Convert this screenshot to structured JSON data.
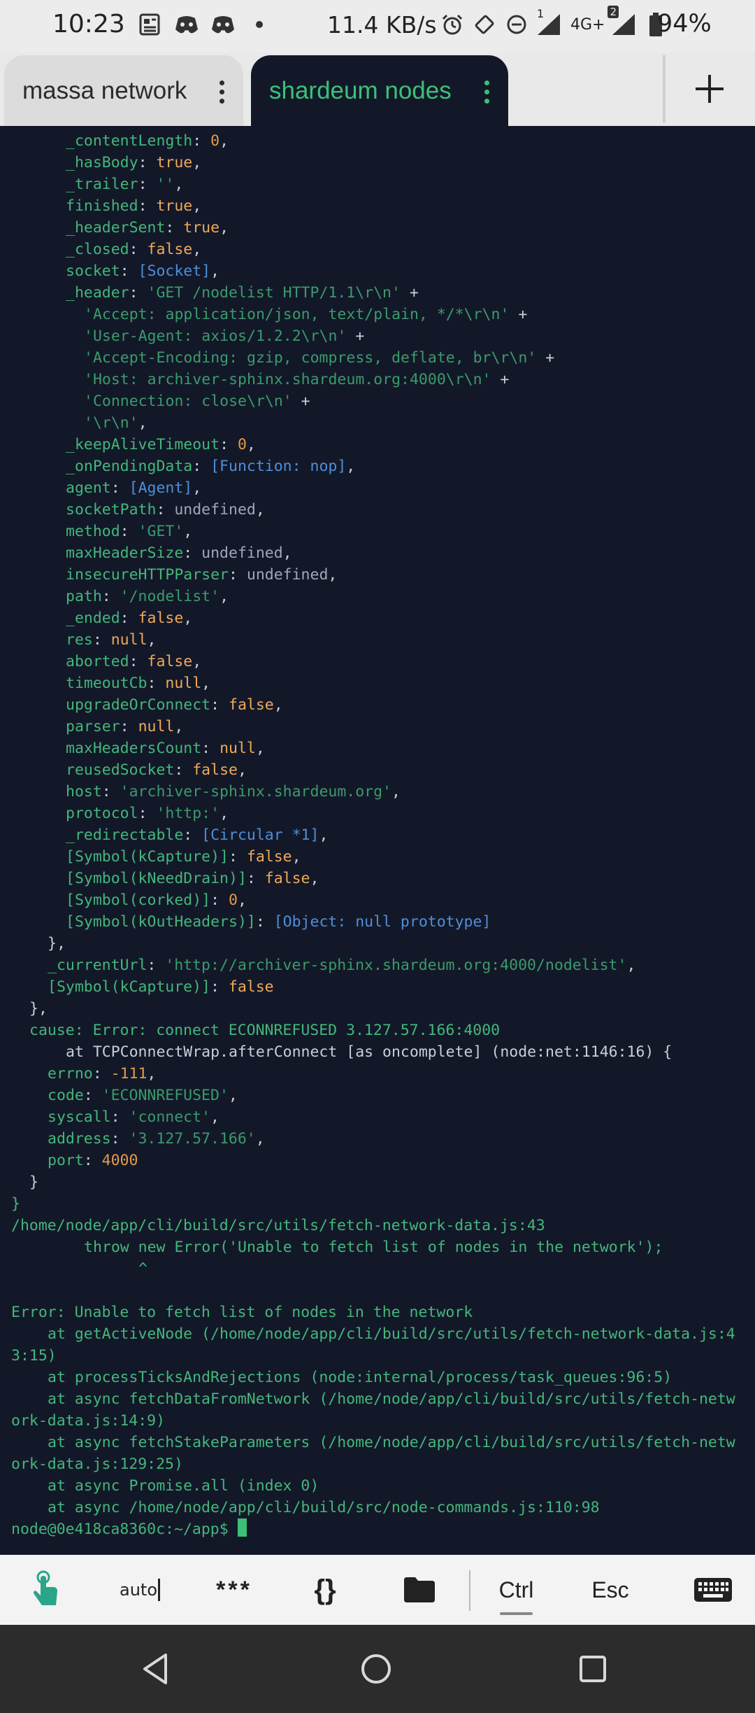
{
  "status_bar": {
    "time": "10:23",
    "net_speed": "11.4 KB/s",
    "sim1_label": "1",
    "network_type": "4G+",
    "sim2_label": "2",
    "battery_percent": "94%",
    "icons_left": [
      "news-icon",
      "discord-icon",
      "discord-icon",
      "dot-icon"
    ],
    "icons_right": [
      "alarm-icon",
      "rotate-icon",
      "dnd-icon",
      "signal-icon",
      "signal-icon",
      "battery-icon"
    ]
  },
  "tabs": [
    {
      "label": "massa network",
      "active": false
    },
    {
      "label": "shardeum nodes",
      "active": true
    }
  ],
  "colors": {
    "accent": "#3cc078",
    "terminal_bg": "#131829",
    "string": "#3a9b6a",
    "number": "#e49a47",
    "special": "#4e8fd9"
  },
  "terminal": {
    "lines": [
      {
        "indent": 6,
        "parts": [
          [
            "k",
            "_contentLength"
          ],
          [
            "p",
            ": "
          ],
          [
            "n",
            "0"
          ],
          [
            "p",
            ","
          ]
        ]
      },
      {
        "indent": 6,
        "parts": [
          [
            "k",
            "_hasBody"
          ],
          [
            "p",
            ": "
          ],
          [
            "b",
            "true"
          ],
          [
            "p",
            ","
          ]
        ]
      },
      {
        "indent": 6,
        "parts": [
          [
            "k",
            "_trailer"
          ],
          [
            "p",
            ": "
          ],
          [
            "s",
            "''"
          ],
          [
            "p",
            ","
          ]
        ]
      },
      {
        "indent": 6,
        "parts": [
          [
            "k",
            "finished"
          ],
          [
            "p",
            ": "
          ],
          [
            "b",
            "true"
          ],
          [
            "p",
            ","
          ]
        ]
      },
      {
        "indent": 6,
        "parts": [
          [
            "k",
            "_headerSent"
          ],
          [
            "p",
            ": "
          ],
          [
            "b",
            "true"
          ],
          [
            "p",
            ","
          ]
        ]
      },
      {
        "indent": 6,
        "parts": [
          [
            "k",
            "_closed"
          ],
          [
            "p",
            ": "
          ],
          [
            "b",
            "false"
          ],
          [
            "p",
            ","
          ]
        ]
      },
      {
        "indent": 6,
        "parts": [
          [
            "k",
            "socket"
          ],
          [
            "p",
            ": "
          ],
          [
            "sp",
            "[Socket]"
          ],
          [
            "p",
            ","
          ]
        ]
      },
      {
        "indent": 6,
        "parts": [
          [
            "k",
            "_header"
          ],
          [
            "p",
            ": "
          ],
          [
            "s",
            "'GET /nodelist HTTP/1.1\\r\\n'"
          ],
          [
            "p",
            " +"
          ]
        ]
      },
      {
        "indent": 8,
        "parts": [
          [
            "s",
            "'Accept: application/json, text/plain, */*\\r\\n'"
          ],
          [
            "p",
            " +"
          ]
        ]
      },
      {
        "indent": 8,
        "parts": [
          [
            "s",
            "'User-Agent: axios/1.2.2\\r\\n'"
          ],
          [
            "p",
            " +"
          ]
        ]
      },
      {
        "indent": 8,
        "parts": [
          [
            "s",
            "'Accept-Encoding: gzip, compress, deflate, br\\r\\n'"
          ],
          [
            "p",
            " +"
          ]
        ]
      },
      {
        "indent": 8,
        "parts": [
          [
            "s",
            "'Host: archiver-sphinx.shardeum.org:4000\\r\\n'"
          ],
          [
            "p",
            " +"
          ]
        ]
      },
      {
        "indent": 8,
        "parts": [
          [
            "s",
            "'Connection: close\\r\\n'"
          ],
          [
            "p",
            " +"
          ]
        ]
      },
      {
        "indent": 8,
        "parts": [
          [
            "s",
            "'\\r\\n'"
          ],
          [
            "p",
            ","
          ]
        ]
      },
      {
        "indent": 6,
        "parts": [
          [
            "k",
            "_keepAliveTimeout"
          ],
          [
            "p",
            ": "
          ],
          [
            "n",
            "0"
          ],
          [
            "p",
            ","
          ]
        ]
      },
      {
        "indent": 6,
        "parts": [
          [
            "k",
            "_onPendingData"
          ],
          [
            "p",
            ": "
          ],
          [
            "sp",
            "[Function: nop]"
          ],
          [
            "p",
            ","
          ]
        ]
      },
      {
        "indent": 6,
        "parts": [
          [
            "k",
            "agent"
          ],
          [
            "p",
            ": "
          ],
          [
            "sp",
            "[Agent]"
          ],
          [
            "p",
            ","
          ]
        ]
      },
      {
        "indent": 6,
        "parts": [
          [
            "k",
            "socketPath"
          ],
          [
            "p",
            ": "
          ],
          [
            "u",
            "undefined"
          ],
          [
            "p",
            ","
          ]
        ]
      },
      {
        "indent": 6,
        "parts": [
          [
            "k",
            "method"
          ],
          [
            "p",
            ": "
          ],
          [
            "s",
            "'GET'"
          ],
          [
            "p",
            ","
          ]
        ]
      },
      {
        "indent": 6,
        "parts": [
          [
            "k",
            "maxHeaderSize"
          ],
          [
            "p",
            ": "
          ],
          [
            "u",
            "undefined"
          ],
          [
            "p",
            ","
          ]
        ]
      },
      {
        "indent": 6,
        "parts": [
          [
            "k",
            "insecureHTTPParser"
          ],
          [
            "p",
            ": "
          ],
          [
            "u",
            "undefined"
          ],
          [
            "p",
            ","
          ]
        ]
      },
      {
        "indent": 6,
        "parts": [
          [
            "k",
            "path"
          ],
          [
            "p",
            ": "
          ],
          [
            "s",
            "'/nodelist'"
          ],
          [
            "p",
            ","
          ]
        ]
      },
      {
        "indent": 6,
        "parts": [
          [
            "k",
            "_ended"
          ],
          [
            "p",
            ": "
          ],
          [
            "b",
            "false"
          ],
          [
            "p",
            ","
          ]
        ]
      },
      {
        "indent": 6,
        "parts": [
          [
            "k",
            "res"
          ],
          [
            "p",
            ": "
          ],
          [
            "b",
            "null"
          ],
          [
            "p",
            ","
          ]
        ]
      },
      {
        "indent": 6,
        "parts": [
          [
            "k",
            "aborted"
          ],
          [
            "p",
            ": "
          ],
          [
            "b",
            "false"
          ],
          [
            "p",
            ","
          ]
        ]
      },
      {
        "indent": 6,
        "parts": [
          [
            "k",
            "timeoutCb"
          ],
          [
            "p",
            ": "
          ],
          [
            "b",
            "null"
          ],
          [
            "p",
            ","
          ]
        ]
      },
      {
        "indent": 6,
        "parts": [
          [
            "k",
            "upgradeOrConnect"
          ],
          [
            "p",
            ": "
          ],
          [
            "b",
            "false"
          ],
          [
            "p",
            ","
          ]
        ]
      },
      {
        "indent": 6,
        "parts": [
          [
            "k",
            "parser"
          ],
          [
            "p",
            ": "
          ],
          [
            "b",
            "null"
          ],
          [
            "p",
            ","
          ]
        ]
      },
      {
        "indent": 6,
        "parts": [
          [
            "k",
            "maxHeadersCount"
          ],
          [
            "p",
            ": "
          ],
          [
            "b",
            "null"
          ],
          [
            "p",
            ","
          ]
        ]
      },
      {
        "indent": 6,
        "parts": [
          [
            "k",
            "reusedSocket"
          ],
          [
            "p",
            ": "
          ],
          [
            "b",
            "false"
          ],
          [
            "p",
            ","
          ]
        ]
      },
      {
        "indent": 6,
        "parts": [
          [
            "k",
            "host"
          ],
          [
            "p",
            ": "
          ],
          [
            "s",
            "'archiver-sphinx.shardeum.org'"
          ],
          [
            "p",
            ","
          ]
        ]
      },
      {
        "indent": 6,
        "parts": [
          [
            "k",
            "protocol"
          ],
          [
            "p",
            ": "
          ],
          [
            "s",
            "'http:'"
          ],
          [
            "p",
            ","
          ]
        ]
      },
      {
        "indent": 6,
        "parts": [
          [
            "k",
            "_redirectable"
          ],
          [
            "p",
            ": "
          ],
          [
            "sp",
            "[Circular *1]"
          ],
          [
            "p",
            ","
          ]
        ]
      },
      {
        "indent": 6,
        "parts": [
          [
            "k",
            "[Symbol(kCapture)]"
          ],
          [
            "p",
            ": "
          ],
          [
            "b",
            "false"
          ],
          [
            "p",
            ","
          ]
        ]
      },
      {
        "indent": 6,
        "parts": [
          [
            "k",
            "[Symbol(kNeedDrain)]"
          ],
          [
            "p",
            ": "
          ],
          [
            "b",
            "false"
          ],
          [
            "p",
            ","
          ]
        ]
      },
      {
        "indent": 6,
        "parts": [
          [
            "k",
            "[Symbol(corked)]"
          ],
          [
            "p",
            ": "
          ],
          [
            "n",
            "0"
          ],
          [
            "p",
            ","
          ]
        ]
      },
      {
        "indent": 6,
        "parts": [
          [
            "k",
            "[Symbol(kOutHeaders)]"
          ],
          [
            "p",
            ": "
          ],
          [
            "sp",
            "[Object: null prototype]"
          ]
        ]
      },
      {
        "indent": 4,
        "parts": [
          [
            "p",
            "},"
          ]
        ]
      },
      {
        "indent": 4,
        "parts": [
          [
            "k",
            "_currentUrl"
          ],
          [
            "p",
            ": "
          ],
          [
            "s",
            "'http://archiver-sphinx.shardeum.org:4000/nodelist'"
          ],
          [
            "p",
            ","
          ]
        ]
      },
      {
        "indent": 4,
        "parts": [
          [
            "k",
            "[Symbol(kCapture)]"
          ],
          [
            "p",
            ": "
          ],
          [
            "b",
            "false"
          ]
        ]
      },
      {
        "indent": 2,
        "parts": [
          [
            "p",
            "},"
          ]
        ]
      },
      {
        "indent": 2,
        "parts": [
          [
            "k",
            "cause: Error: connect ECONNREFUSED 3.127.57.166:4000"
          ]
        ]
      },
      {
        "indent": 6,
        "parts": [
          [
            "p",
            "at TCPConnectWrap.afterConnect [as oncomplete] (node:net:1146:16) {"
          ]
        ]
      },
      {
        "indent": 4,
        "parts": [
          [
            "k",
            "errno"
          ],
          [
            "p",
            ": "
          ],
          [
            "n",
            "-111"
          ],
          [
            "p",
            ","
          ]
        ]
      },
      {
        "indent": 4,
        "parts": [
          [
            "k",
            "code"
          ],
          [
            "p",
            ": "
          ],
          [
            "s",
            "'ECONNREFUSED'"
          ],
          [
            "p",
            ","
          ]
        ]
      },
      {
        "indent": 4,
        "parts": [
          [
            "k",
            "syscall"
          ],
          [
            "p",
            ": "
          ],
          [
            "s",
            "'connect'"
          ],
          [
            "p",
            ","
          ]
        ]
      },
      {
        "indent": 4,
        "parts": [
          [
            "k",
            "address"
          ],
          [
            "p",
            ": "
          ],
          [
            "s",
            "'3.127.57.166'"
          ],
          [
            "p",
            ","
          ]
        ]
      },
      {
        "indent": 4,
        "parts": [
          [
            "k",
            "port"
          ],
          [
            "p",
            ": "
          ],
          [
            "n",
            "4000"
          ]
        ]
      },
      {
        "indent": 2,
        "parts": [
          [
            "p",
            "}"
          ]
        ]
      },
      {
        "indent": 0,
        "parts": [
          [
            "k",
            "}"
          ]
        ]
      },
      {
        "indent": 0,
        "parts": [
          [
            "k",
            "/home/node/app/cli/build/src/utils/fetch-network-data.js:43"
          ]
        ]
      },
      {
        "indent": 8,
        "parts": [
          [
            "k",
            "throw new Error('Unable to fetch list of nodes in the network');"
          ]
        ]
      },
      {
        "indent": 14,
        "parts": [
          [
            "k",
            "^"
          ]
        ]
      },
      {
        "indent": 0,
        "parts": []
      },
      {
        "indent": 0,
        "parts": [
          [
            "k",
            "Error: Unable to fetch list of nodes in the network"
          ]
        ]
      },
      {
        "indent": 4,
        "parts": [
          [
            "k",
            "at getActiveNode (/home/node/app/cli/build/src/utils/fetch-network-data.js:4"
          ]
        ]
      },
      {
        "indent": 0,
        "parts": [
          [
            "k",
            "3:15)"
          ]
        ]
      },
      {
        "indent": 4,
        "parts": [
          [
            "k",
            "at processTicksAndRejections (node:internal/process/task_queues:96:5)"
          ]
        ]
      },
      {
        "indent": 4,
        "parts": [
          [
            "k",
            "at async fetchDataFromNetwork (/home/node/app/cli/build/src/utils/fetch-netw"
          ]
        ]
      },
      {
        "indent": 0,
        "parts": [
          [
            "k",
            "ork-data.js:14:9)"
          ]
        ]
      },
      {
        "indent": 4,
        "parts": [
          [
            "k",
            "at async fetchStakeParameters (/home/node/app/cli/build/src/utils/fetch-netw"
          ]
        ]
      },
      {
        "indent": 0,
        "parts": [
          [
            "k",
            "ork-data.js:129:25)"
          ]
        ]
      },
      {
        "indent": 4,
        "parts": [
          [
            "k",
            "at async Promise.all (index 0)"
          ]
        ]
      },
      {
        "indent": 4,
        "parts": [
          [
            "k",
            "at async /home/node/app/cli/build/src/node-commands.js:110:98"
          ]
        ]
      },
      {
        "indent": 0,
        "parts": [
          [
            "k",
            "node@0e418ca8360c:~/app$ "
          ]
        ],
        "cursor": true
      }
    ]
  },
  "extra_keys": {
    "touch_icon": "hand-pointer-icon",
    "auto_label": "auto",
    "password_label": "***",
    "braces_label": "{}",
    "folder_icon": "folder-icon",
    "ctrl_label": "Ctrl",
    "esc_label": "Esc",
    "keyboard_icon": "keyboard-icon"
  },
  "nav_bar": {
    "buttons": [
      "back-icon",
      "home-icon",
      "recents-icon"
    ]
  }
}
